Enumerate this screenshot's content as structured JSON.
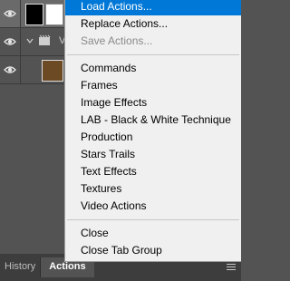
{
  "layers": {
    "rows": [
      {
        "name": "layer-row-1"
      },
      {
        "name": "layer-row-2-group",
        "label": "V"
      },
      {
        "name": "layer-row-3"
      }
    ]
  },
  "panel_tabs": [
    {
      "label": "History"
    },
    {
      "label": "Actions"
    }
  ],
  "menu": {
    "items": [
      {
        "label": "Load Actions...",
        "state": "highlighted"
      },
      {
        "label": "Replace Actions...",
        "state": "normal"
      },
      {
        "label": "Save Actions...",
        "state": "disabled"
      },
      {
        "label": "Commands",
        "state": "normal"
      },
      {
        "label": "Frames",
        "state": "normal"
      },
      {
        "label": "Image Effects",
        "state": "normal"
      },
      {
        "label": "LAB - Black & White Technique",
        "state": "normal"
      },
      {
        "label": "Production",
        "state": "normal"
      },
      {
        "label": "Stars Trails",
        "state": "normal"
      },
      {
        "label": "Text Effects",
        "state": "normal"
      },
      {
        "label": "Textures",
        "state": "normal"
      },
      {
        "label": "Video Actions",
        "state": "normal"
      },
      {
        "label": "Close",
        "state": "normal"
      },
      {
        "label": "Close Tab Group",
        "state": "normal"
      }
    ]
  },
  "colors": {
    "highlight": "#0078d7",
    "menu_bg": "#f0f0f0",
    "panel_bg": "#535353"
  }
}
